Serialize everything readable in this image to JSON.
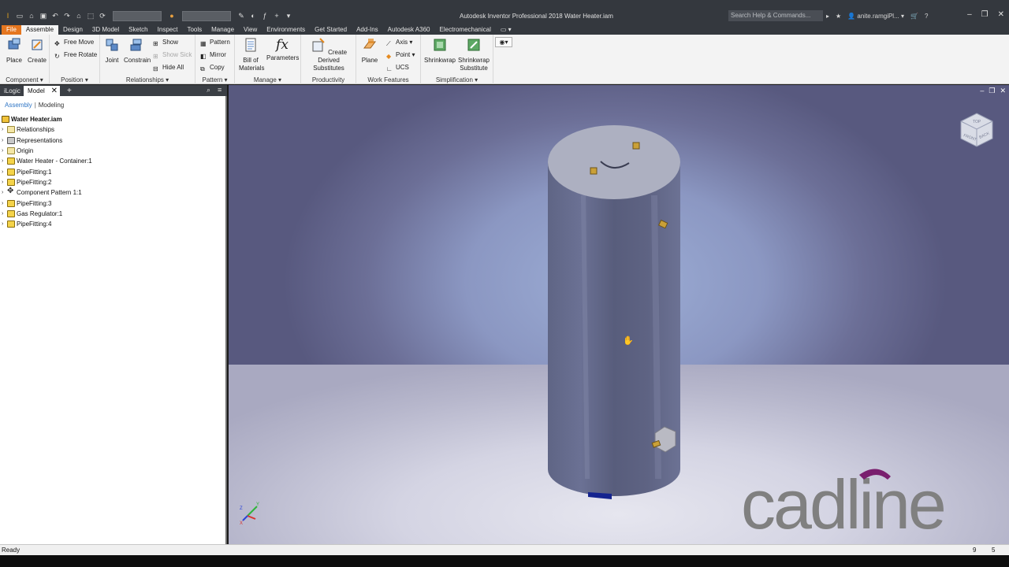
{
  "window": {
    "title": "Autodesk Inventor Professional 2018   Water Heater.iam",
    "search_placeholder": "Search Help & Commands...",
    "user": "anite.ramgiPl...",
    "user_caret": "▾"
  },
  "ribbon_tabs": [
    "File",
    "Assemble",
    "Design",
    "3D Model",
    "Sketch",
    "Inspect",
    "Tools",
    "Manage",
    "View",
    "Environments",
    "Get Started",
    "Add-Ins",
    "Autodesk A360",
    "Electromechanical"
  ],
  "ribbon": {
    "component": {
      "label": "Component ▾",
      "place": "Place",
      "create": "Create"
    },
    "position": {
      "label": "Position ▾",
      "free_move": "Free Move",
      "free_rotate": "Free Rotate"
    },
    "relationships": {
      "label": "Relationships ▾",
      "joint": "Joint",
      "constrain": "Constrain",
      "show": "Show",
      "show_sick": "Show Sick",
      "hide_all": "Hide All"
    },
    "pattern": {
      "label": "Pattern ▾",
      "pattern": "Pattern",
      "mirror": "Mirror",
      "copy": "Copy"
    },
    "manage": {
      "label": "Manage ▾",
      "bom_line1": "Bill of",
      "bom_line2": "Materials",
      "parameters": "Parameters"
    },
    "productivity": {
      "label": "Productivity",
      "derived_line1": "Create Derived",
      "derived_line2": "Substitutes"
    },
    "work_features": {
      "label": "Work Features",
      "plane": "Plane",
      "axis": "Axis ▾",
      "point": "Point ▾",
      "ucs": "UCS"
    },
    "simplification": {
      "label": "Simplification ▾",
      "shrinkwrap": "Shrinkwrap",
      "sub_line1": "Shrinkwrap",
      "sub_line2": "Substitute"
    }
  },
  "browser": {
    "tabs": {
      "ilogic": "iLogic",
      "model": "Model",
      "close": "✕",
      "add": "+"
    },
    "subtabs": {
      "assembly": "Assembly",
      "separator": "|",
      "modeling": "Modeling"
    },
    "root": "Water Heater.iam",
    "nodes": [
      {
        "label": "Relationships",
        "kind": "rel"
      },
      {
        "label": "Representations",
        "kind": "rel"
      },
      {
        "label": "Origin",
        "kind": "folder"
      },
      {
        "label": "Water Heater - Container:1",
        "kind": "part"
      },
      {
        "label": "PipeFitting:1",
        "kind": "part"
      },
      {
        "label": "PipeFitting:2",
        "kind": "part"
      },
      {
        "label": "Component Pattern 1:1",
        "kind": "pattern"
      },
      {
        "label": "PipeFitting:3",
        "kind": "part"
      },
      {
        "label": "Gas Regulator:1",
        "kind": "part"
      },
      {
        "label": "PipeFitting:4",
        "kind": "part"
      }
    ]
  },
  "viewport": {
    "viewcube_labels": {
      "front": "FRONT",
      "right": "BACK",
      "top": "TOP"
    },
    "watermark": "cadline",
    "triad": {
      "x": "X",
      "y": "Y",
      "z": "Z"
    }
  },
  "statusbar": {
    "status": "Ready",
    "count1": "9",
    "count2": "5"
  },
  "colors": {
    "accent": "#e5761f",
    "title_bar": "#34383e",
    "brand_purple": "#7a1f6e"
  }
}
